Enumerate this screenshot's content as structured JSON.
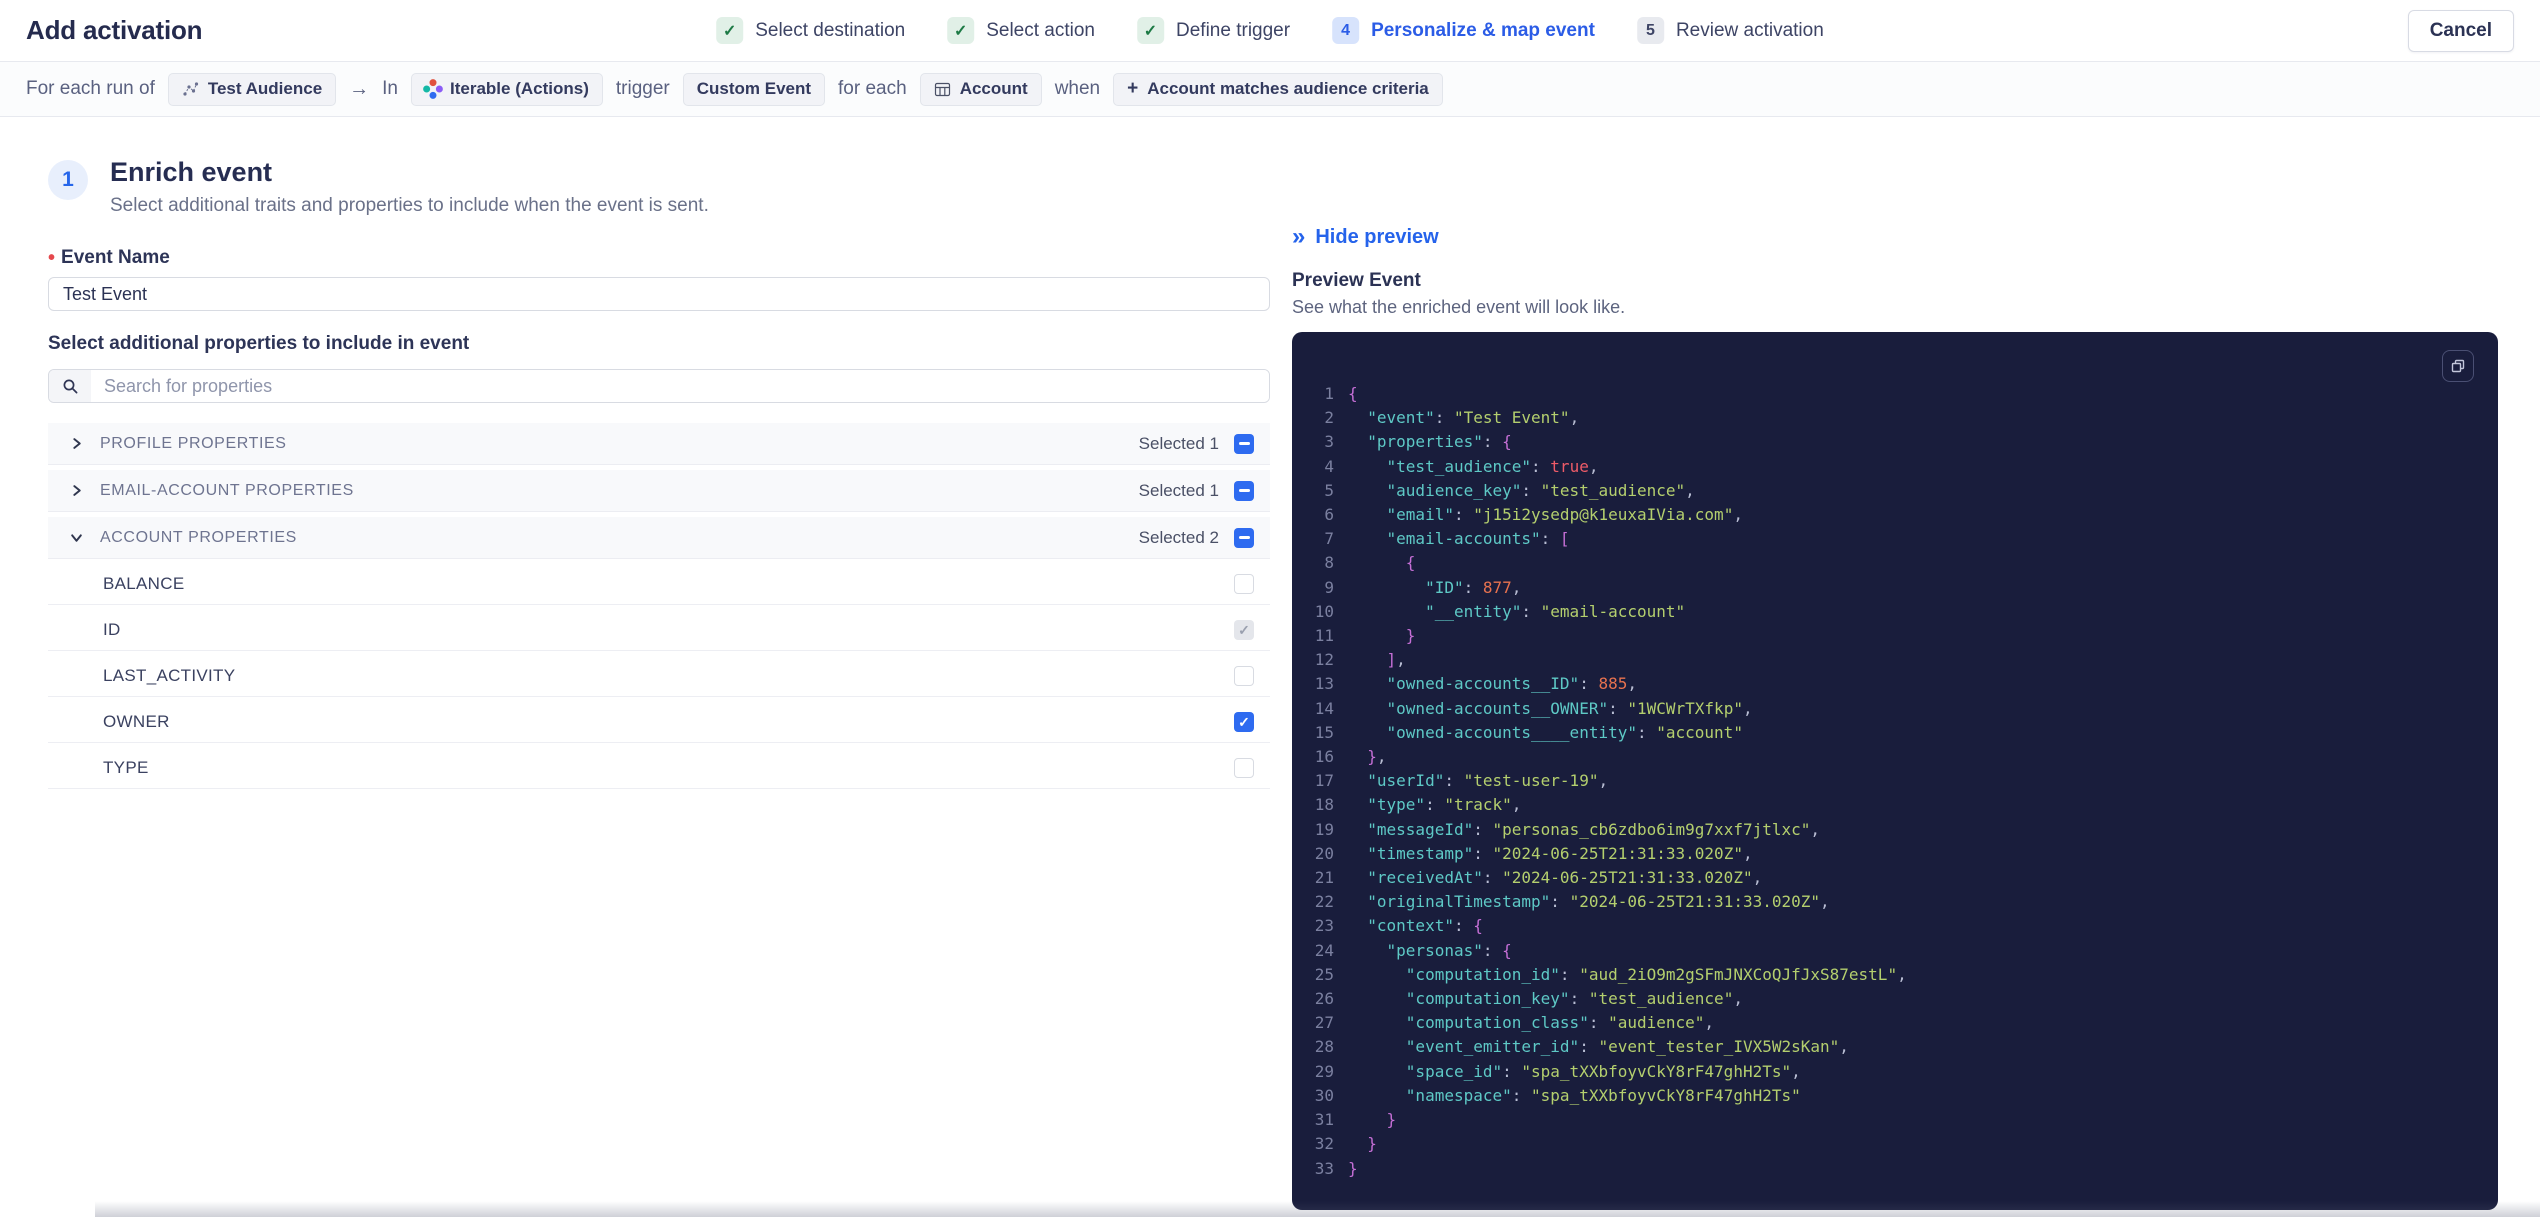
{
  "header": {
    "title": "Add activation",
    "cancel_label": "Cancel",
    "check_glyph": "✓",
    "steps": [
      {
        "label": "Select destination",
        "state": "done"
      },
      {
        "label": "Select action",
        "state": "done"
      },
      {
        "label": "Define trigger",
        "state": "done"
      },
      {
        "number": "4",
        "label": "Personalize & map event",
        "state": "active"
      },
      {
        "number": "5",
        "label": "Review activation",
        "state": "upcoming"
      }
    ]
  },
  "trigger_bar": {
    "prefix": "For each run of",
    "audience_chip": "Test Audience",
    "arrow": "→",
    "in_label": "In",
    "destination_chip": "Iterable (Actions)",
    "trigger_label": "trigger",
    "event_chip": "Custom Event",
    "for_each_label": "for each",
    "entity_chip": "Account",
    "when_label": "when",
    "criteria_plus": "+",
    "criteria_chip": "Account matches audience criteria"
  },
  "enrich": {
    "step_number": "1",
    "title": "Enrich event",
    "subtitle": "Select additional traits and properties to include when the event is sent.",
    "required_marker": "•",
    "event_name_label": "Event Name",
    "event_name_value": "Test Event",
    "properties_label": "Select additional properties to include in event",
    "search_placeholder": "Search for properties",
    "groups": [
      {
        "label": "PROFILE PROPERTIES",
        "selected": "Selected 1",
        "state": "indeterminate",
        "expanded": false
      },
      {
        "label": "EMAIL-ACCOUNT PROPERTIES",
        "selected": "Selected 1",
        "state": "indeterminate",
        "expanded": false
      },
      {
        "label": "ACCOUNT PROPERTIES",
        "selected": "Selected 2",
        "state": "indeterminate",
        "expanded": true
      }
    ],
    "account_properties": [
      {
        "label": "BALANCE",
        "checked": false,
        "disabled": false
      },
      {
        "label": "ID",
        "checked": true,
        "disabled": true
      },
      {
        "label": "LAST_ACTIVITY",
        "checked": false,
        "disabled": false
      },
      {
        "label": "OWNER",
        "checked": true,
        "disabled": false
      },
      {
        "label": "TYPE",
        "checked": false,
        "disabled": false
      }
    ]
  },
  "preview": {
    "hide_label": "Hide preview",
    "collapse_glyph": "»",
    "title": "Preview Event",
    "subtitle": "See what the enriched event will look like.",
    "code": {
      "lines": [
        {
          "n": "1",
          "t": [
            [
              "br",
              "{"
            ]
          ]
        },
        {
          "n": "2",
          "t": [
            [
              "sp",
              "  "
            ],
            [
              "key",
              "\"event\""
            ],
            [
              "pn",
              ": "
            ],
            [
              "st",
              "\"Test Event\""
            ],
            [
              "pn",
              ","
            ]
          ]
        },
        {
          "n": "3",
          "t": [
            [
              "sp",
              "  "
            ],
            [
              "key",
              "\"properties\""
            ],
            [
              "pn",
              ": "
            ],
            [
              "br",
              "{"
            ]
          ]
        },
        {
          "n": "4",
          "t": [
            [
              "sp",
              "    "
            ],
            [
              "key",
              "\"test_audience\""
            ],
            [
              "pn",
              ": "
            ],
            [
              "bo",
              "true"
            ],
            [
              "pn",
              ","
            ]
          ]
        },
        {
          "n": "5",
          "t": [
            [
              "sp",
              "    "
            ],
            [
              "key",
              "\"audience_key\""
            ],
            [
              "pn",
              ": "
            ],
            [
              "st",
              "\"test_audience\""
            ],
            [
              "pn",
              ","
            ]
          ]
        },
        {
          "n": "6",
          "t": [
            [
              "sp",
              "    "
            ],
            [
              "key",
              "\"email\""
            ],
            [
              "pn",
              ": "
            ],
            [
              "st",
              "\"j15i2ysedp@k1euxaIVia.com\""
            ],
            [
              "pn",
              ","
            ]
          ]
        },
        {
          "n": "7",
          "t": [
            [
              "sp",
              "    "
            ],
            [
              "key",
              "\"email-accounts\""
            ],
            [
              "pn",
              ": "
            ],
            [
              "br",
              "["
            ]
          ]
        },
        {
          "n": "8",
          "t": [
            [
              "sp",
              "      "
            ],
            [
              "br",
              "{"
            ]
          ]
        },
        {
          "n": "9",
          "t": [
            [
              "sp",
              "        "
            ],
            [
              "key",
              "\"ID\""
            ],
            [
              "pn",
              ": "
            ],
            [
              "nu",
              "877"
            ],
            [
              "pn",
              ","
            ]
          ]
        },
        {
          "n": "10",
          "t": [
            [
              "sp",
              "        "
            ],
            [
              "key",
              "\"__entity\""
            ],
            [
              "pn",
              ": "
            ],
            [
              "st",
              "\"email-account\""
            ]
          ]
        },
        {
          "n": "11",
          "t": [
            [
              "sp",
              "      "
            ],
            [
              "br",
              "}"
            ]
          ]
        },
        {
          "n": "12",
          "t": [
            [
              "sp",
              "    "
            ],
            [
              "br",
              "]"
            ],
            [
              "pn",
              ","
            ]
          ]
        },
        {
          "n": "13",
          "t": [
            [
              "sp",
              "    "
            ],
            [
              "key",
              "\"owned-accounts__ID\""
            ],
            [
              "pn",
              ": "
            ],
            [
              "nu",
              "885"
            ],
            [
              "pn",
              ","
            ]
          ]
        },
        {
          "n": "14",
          "t": [
            [
              "sp",
              "    "
            ],
            [
              "key",
              "\"owned-accounts__OWNER\""
            ],
            [
              "pn",
              ": "
            ],
            [
              "st",
              "\"1WCWrTXfkp\""
            ],
            [
              "pn",
              ","
            ]
          ]
        },
        {
          "n": "15",
          "t": [
            [
              "sp",
              "    "
            ],
            [
              "key",
              "\"owned-accounts____entity\""
            ],
            [
              "pn",
              ": "
            ],
            [
              "st",
              "\"account\""
            ]
          ]
        },
        {
          "n": "16",
          "t": [
            [
              "sp",
              "  "
            ],
            [
              "br",
              "}"
            ],
            [
              "pn",
              ","
            ]
          ]
        },
        {
          "n": "17",
          "t": [
            [
              "sp",
              "  "
            ],
            [
              "key",
              "\"userId\""
            ],
            [
              "pn",
              ": "
            ],
            [
              "st",
              "\"test-user-19\""
            ],
            [
              "pn",
              ","
            ]
          ]
        },
        {
          "n": "18",
          "t": [
            [
              "sp",
              "  "
            ],
            [
              "key",
              "\"type\""
            ],
            [
              "pn",
              ": "
            ],
            [
              "st",
              "\"track\""
            ],
            [
              "pn",
              ","
            ]
          ]
        },
        {
          "n": "19",
          "t": [
            [
              "sp",
              "  "
            ],
            [
              "key",
              "\"messageId\""
            ],
            [
              "pn",
              ": "
            ],
            [
              "st",
              "\"personas_cb6zdbo6im9g7xxf7jtlxc\""
            ],
            [
              "pn",
              ","
            ]
          ]
        },
        {
          "n": "20",
          "t": [
            [
              "sp",
              "  "
            ],
            [
              "key",
              "\"timestamp\""
            ],
            [
              "pn",
              ": "
            ],
            [
              "st",
              "\"2024-06-25T21:31:33.020Z\""
            ],
            [
              "pn",
              ","
            ]
          ]
        },
        {
          "n": "21",
          "t": [
            [
              "sp",
              "  "
            ],
            [
              "key",
              "\"receivedAt\""
            ],
            [
              "pn",
              ": "
            ],
            [
              "st",
              "\"2024-06-25T21:31:33.020Z\""
            ],
            [
              "pn",
              ","
            ]
          ]
        },
        {
          "n": "22",
          "t": [
            [
              "sp",
              "  "
            ],
            [
              "key",
              "\"originalTimestamp\""
            ],
            [
              "pn",
              ": "
            ],
            [
              "st",
              "\"2024-06-25T21:31:33.020Z\""
            ],
            [
              "pn",
              ","
            ]
          ]
        },
        {
          "n": "23",
          "t": [
            [
              "sp",
              "  "
            ],
            [
              "key",
              "\"context\""
            ],
            [
              "pn",
              ": "
            ],
            [
              "br",
              "{"
            ]
          ]
        },
        {
          "n": "24",
          "t": [
            [
              "sp",
              "    "
            ],
            [
              "key",
              "\"personas\""
            ],
            [
              "pn",
              ": "
            ],
            [
              "br",
              "{"
            ]
          ]
        },
        {
          "n": "25",
          "t": [
            [
              "sp",
              "      "
            ],
            [
              "key",
              "\"computation_id\""
            ],
            [
              "pn",
              ": "
            ],
            [
              "st",
              "\"aud_2iO9m2gSFmJNXCoQJfJxS87estL\""
            ],
            [
              "pn",
              ","
            ]
          ]
        },
        {
          "n": "26",
          "t": [
            [
              "sp",
              "      "
            ],
            [
              "key",
              "\"computation_key\""
            ],
            [
              "pn",
              ": "
            ],
            [
              "st",
              "\"test_audience\""
            ],
            [
              "pn",
              ","
            ]
          ]
        },
        {
          "n": "27",
          "t": [
            [
              "sp",
              "      "
            ],
            [
              "key",
              "\"computation_class\""
            ],
            [
              "pn",
              ": "
            ],
            [
              "st",
              "\"audience\""
            ],
            [
              "pn",
              ","
            ]
          ]
        },
        {
          "n": "28",
          "t": [
            [
              "sp",
              "      "
            ],
            [
              "key",
              "\"event_emitter_id\""
            ],
            [
              "pn",
              ": "
            ],
            [
              "st",
              "\"event_tester_IVX5W2sKan\""
            ],
            [
              "pn",
              ","
            ]
          ]
        },
        {
          "n": "29",
          "t": [
            [
              "sp",
              "      "
            ],
            [
              "key",
              "\"space_id\""
            ],
            [
              "pn",
              ": "
            ],
            [
              "st",
              "\"spa_tXXbfoyvCkY8rF47ghH2Ts\""
            ],
            [
              "pn",
              ","
            ]
          ]
        },
        {
          "n": "30",
          "t": [
            [
              "sp",
              "      "
            ],
            [
              "key",
              "\"namespace\""
            ],
            [
              "pn",
              ": "
            ],
            [
              "st",
              "\"spa_tXXbfoyvCkY8rF47ghH2Ts\""
            ]
          ]
        },
        {
          "n": "31",
          "t": [
            [
              "sp",
              "    "
            ],
            [
              "br",
              "}"
            ]
          ]
        },
        {
          "n": "32",
          "t": [
            [
              "sp",
              "  "
            ],
            [
              "br",
              "}"
            ]
          ]
        },
        {
          "n": "33",
          "t": [
            [
              "br",
              "}"
            ]
          ]
        }
      ]
    }
  },
  "colors": {
    "accent_blue": "#2b5ce6",
    "link_blue": "#2563eb",
    "success_green": "#1d7a45",
    "checkbox_blue": "#2e6bf0",
    "required_red": "#e5484d",
    "code_bg": "#191d3c",
    "code_key": "#5ec9c6",
    "code_string": "#b4cf6e",
    "code_number": "#e8724f",
    "code_boolean": "#ee5b68",
    "code_brace": "#c56fd6"
  }
}
